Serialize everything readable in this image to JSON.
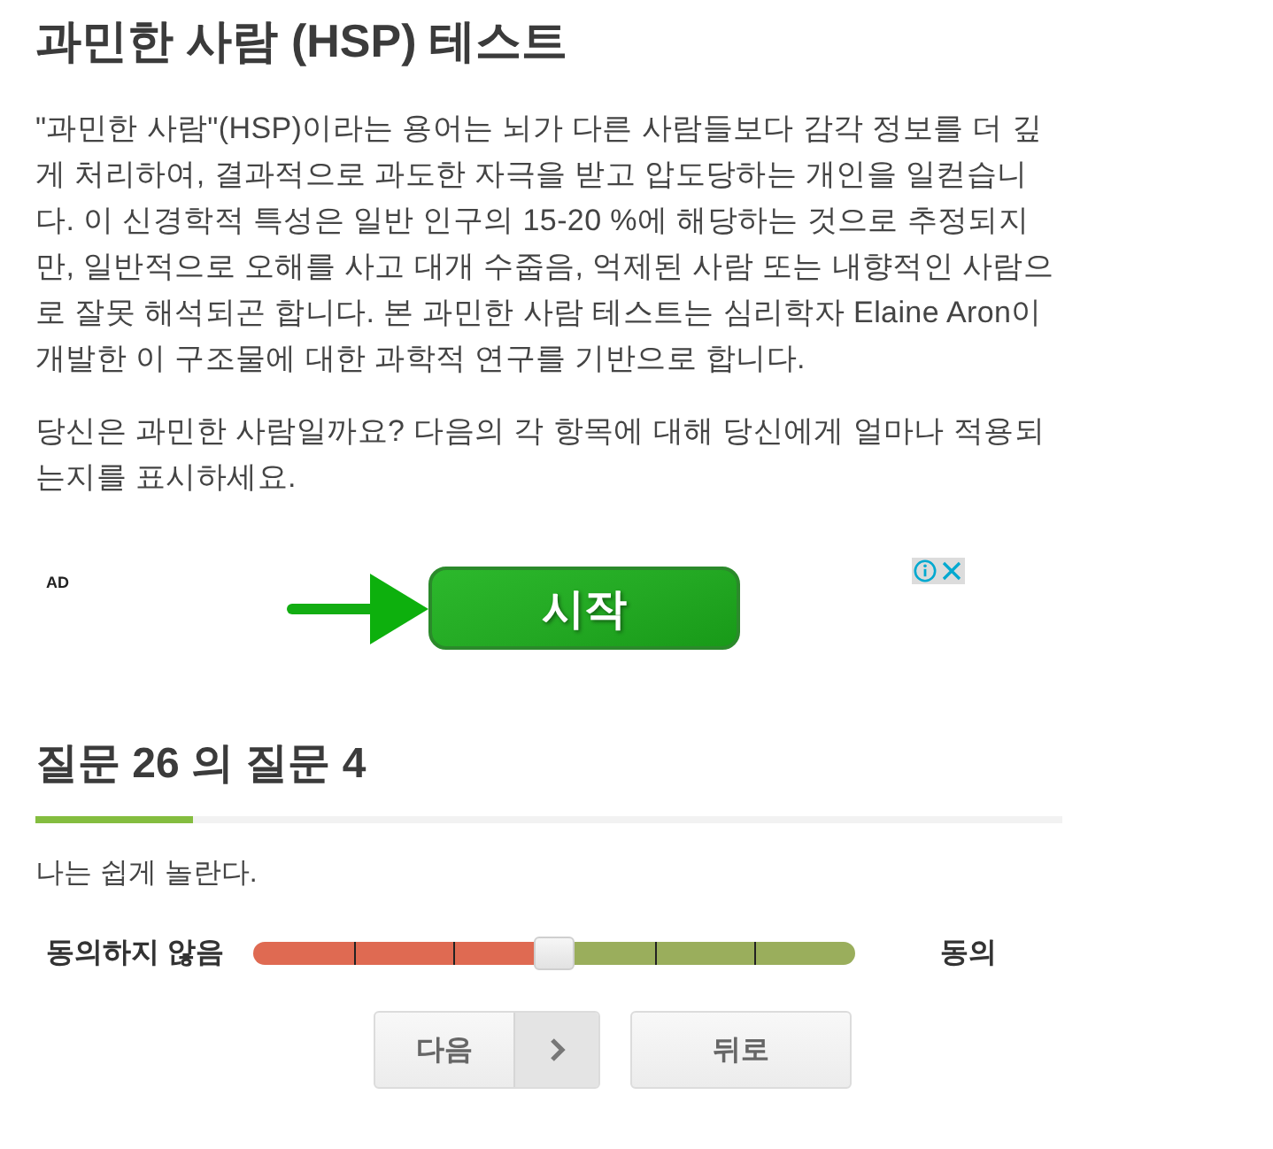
{
  "title": "과민한 사람 (HSP) 테스트",
  "intro": [
    "\"과민한 사람\"(HSP)이라는 용어는 뇌가 다른 사람들보다 감각 정보를 더 깊게 처리하여, 결과적으로 과도한 자극을 받고 압도당하는 개인을 일컫습니다. 이 신경학적 특성은 일반 인구의 15-20 %에 해당하는 것으로 추정되지만, 일반적으로 오해를 사고 대개 수줍음, 억제된 사람 또는 내향적인 사람으로 잘못 해석되곤 합니다. 본 과민한 사람 테스트는 심리학자 Elaine Aron이 개발한 이 구조물에 대한 과학적 연구를 기반으로 합니다.",
    "당신은 과민한 사람일까요? 다음의 각 항목에 대해 당신에게 얼마나 적용되는지를 표시하세요."
  ],
  "ad": {
    "label": "AD",
    "button": "시작"
  },
  "quiz": {
    "heading": "질문 26 의 질문 4",
    "progress": {
      "level": 0.154
    },
    "question": "나는 쉽게 놀란다.",
    "answer": {
      "left_label": "동의하지 않음",
      "right_label": "동의",
      "level": 0.5
    }
  },
  "buttons": [
    {
      "label": "다음",
      "kind": "next"
    },
    {
      "label": "뒤로",
      "kind": "back"
    }
  ]
}
